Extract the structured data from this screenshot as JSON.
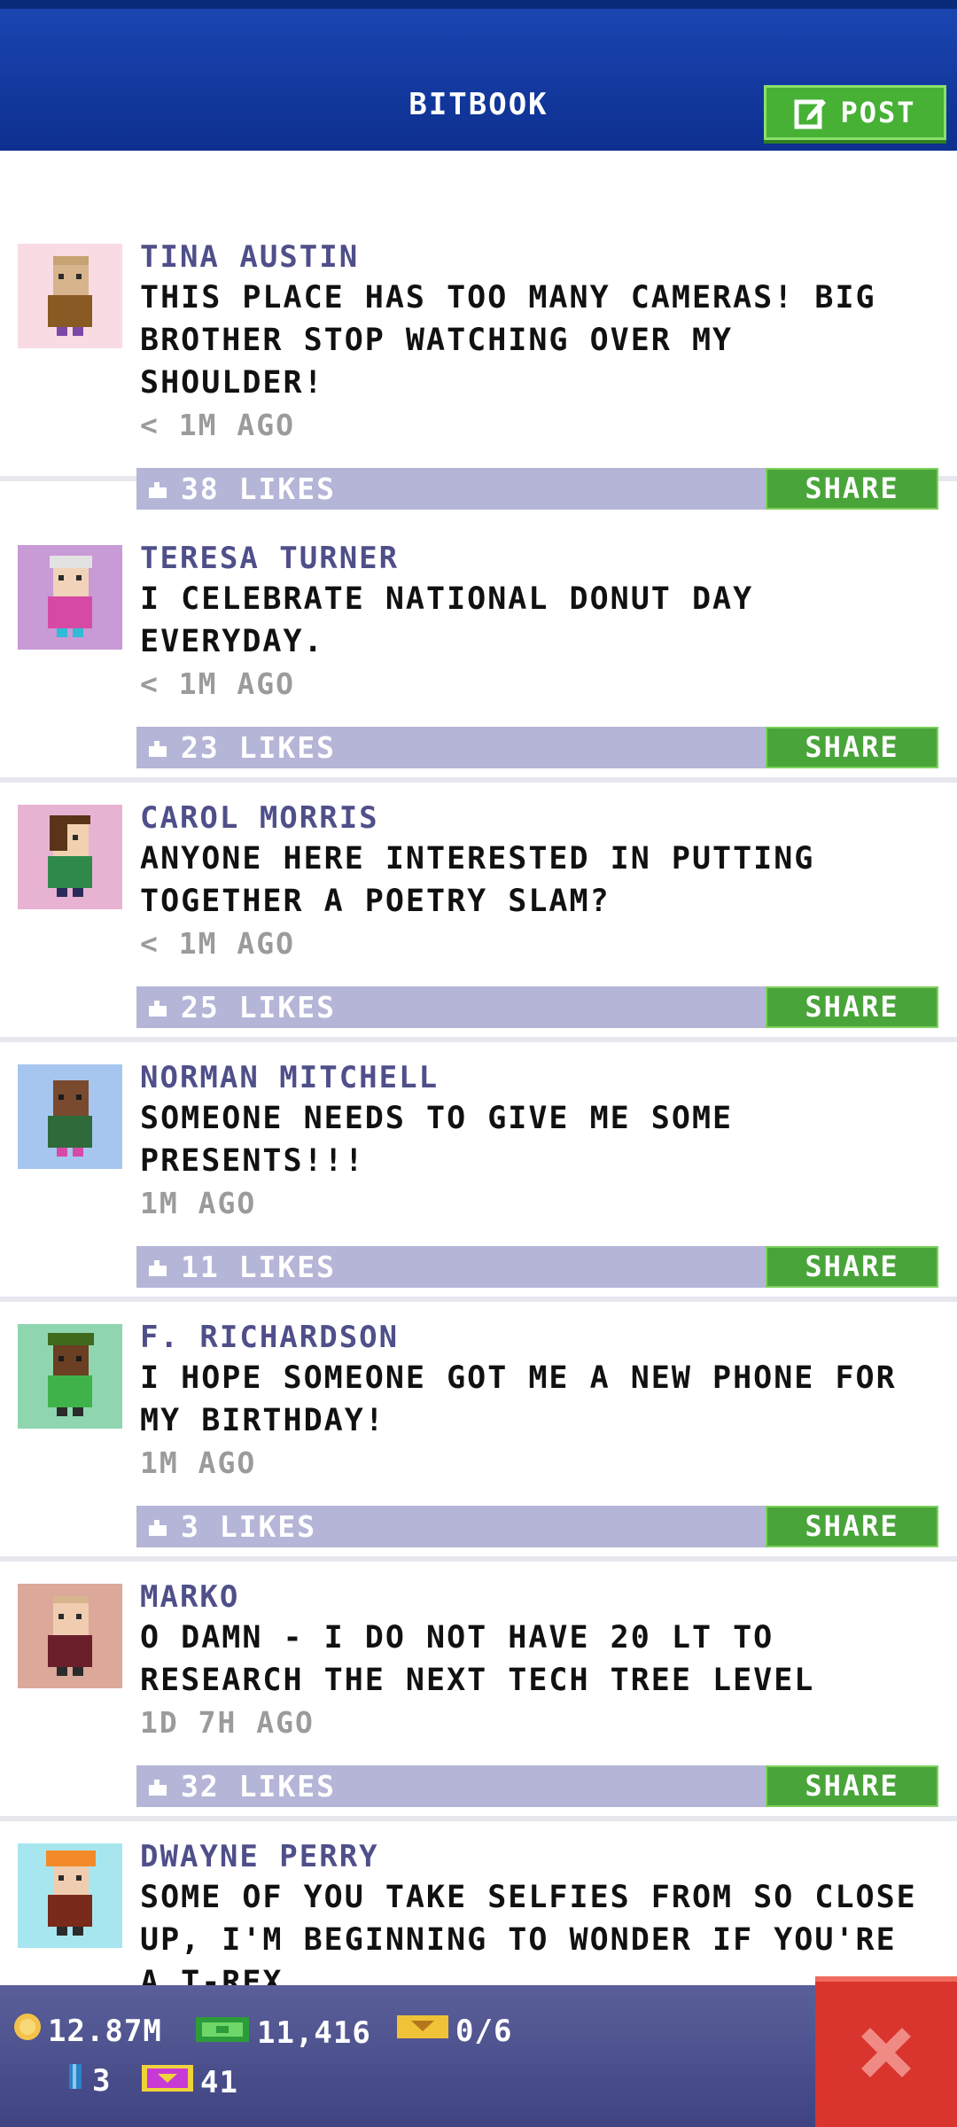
{
  "header": {
    "title": "BITBOOK",
    "post_label": "POST"
  },
  "posts": [
    {
      "name": "TINA AUSTIN",
      "message": "THIS PLACE HAS TOO MANY CAMERAS! BIG BROTHER STOP WATCHING OVER MY SHOULDER!",
      "time": "< 1M AGO",
      "likes": "38 LIKES",
      "share": "SHARE"
    },
    {
      "name": "TERESA TURNER",
      "message": "I CELEBRATE NATIONAL DONUT DAY EVERYDAY.",
      "time": "< 1M AGO",
      "likes": "23 LIKES",
      "share": "SHARE"
    },
    {
      "name": "CAROL MORRIS",
      "message": "ANYONE HERE INTERESTED IN PUTTING TOGETHER A POETRY SLAM?",
      "time": "< 1M AGO",
      "likes": "25 LIKES",
      "share": "SHARE"
    },
    {
      "name": "NORMAN MITCHELL",
      "message": "SOMEONE NEEDS TO GIVE ME SOME PRESENTS!!!",
      "time": "1M AGO",
      "likes": "11 LIKES",
      "share": "SHARE"
    },
    {
      "name": "F. RICHARDSON",
      "message": "I HOPE SOMEONE GOT ME A NEW PHONE FOR MY BIRTHDAY!",
      "time": "1M AGO",
      "likes": "3 LIKES",
      "share": "SHARE"
    },
    {
      "name": "MARKO",
      "message": "O DAMN - I DO NOT HAVE 20 LT TO RESEARCH THE NEXT TECH TREE LEVEL",
      "time": "1D 7H AGO",
      "likes": "32 LIKES",
      "share": "SHARE"
    },
    {
      "name": "DWAYNE PERRY",
      "message": "SOME OF YOU TAKE SELFIES FROM SO CLOSE UP, I'M BEGINNING TO WONDER IF YOU'RE A T-REX",
      "time": "",
      "likes": "",
      "share": ""
    }
  ],
  "status": {
    "coins": "12.87M",
    "bux": "11,416",
    "tickets": "0/6",
    "keys": "3",
    "vip": "41"
  },
  "colors": {
    "header": "#1b47b4",
    "post_button": "#47b136",
    "likes_bar": "#b5b5d8",
    "share_button": "#49a43a",
    "status_bar": "#4b4f8a",
    "close_button": "#d9342d"
  },
  "icons": {
    "post": "edit-icon",
    "like": "thumbs-up-icon",
    "close": "close-icon",
    "coin": "coin-icon",
    "bux": "bux-icon",
    "ticket": "ticket-icon",
    "key": "key-icon",
    "vip": "vip-icon"
  }
}
